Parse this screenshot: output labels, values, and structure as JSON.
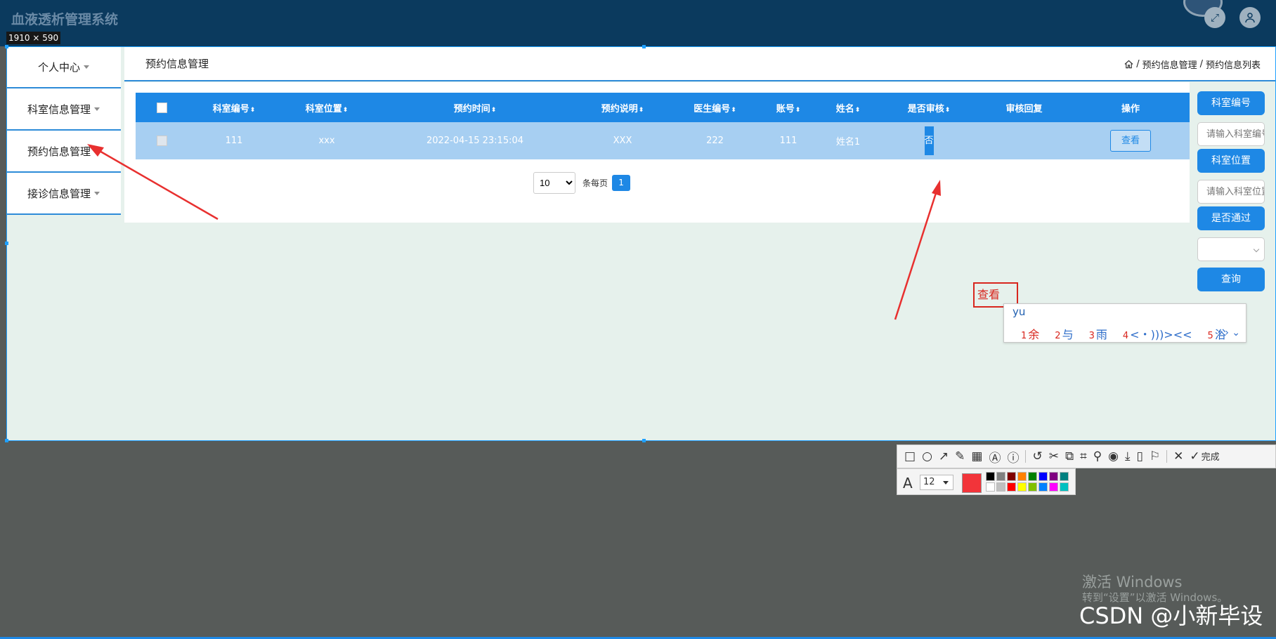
{
  "app": {
    "title": "血液透析管理系统"
  },
  "capture": {
    "dimensions": "1910 × 590"
  },
  "sidebar": {
    "items": [
      {
        "label": "个人中心"
      },
      {
        "label": "科室信息管理"
      },
      {
        "label": "预约信息管理"
      },
      {
        "label": "接诊信息管理"
      }
    ]
  },
  "header": {
    "title": "预约信息管理",
    "breadcrumb": [
      "预约信息管理",
      "预约信息列表"
    ]
  },
  "table": {
    "columns": [
      "科室编号",
      "科室位置",
      "预约时间",
      "预约说明",
      "医生编号",
      "账号",
      "姓名",
      "是否审核",
      "审核回复",
      "操作"
    ],
    "rows": [
      {
        "dept_no": "111",
        "location": "xxx",
        "time": "2022-04-15 23:15:04",
        "note": "XXX",
        "doctor_no": "222",
        "account": "111",
        "name": "姓名1",
        "reviewed": "否",
        "reply": "",
        "action": "查看"
      }
    ]
  },
  "pagination": {
    "page_size": "10",
    "per_page_label": "条每页",
    "current_page": "1"
  },
  "search_panel": {
    "dept_no_button": "科室编号",
    "dept_no_placeholder": "请输入科室编号",
    "location_button": "科室位置",
    "location_placeholder": "请输入科室位置",
    "pass_button": "是否通过",
    "pass_value": "",
    "query_button": "查询"
  },
  "annotation": {
    "text": "查看",
    "ime_input": "yu",
    "ime_candidates": [
      {
        "num": "1",
        "text": "余"
      },
      {
        "num": "2",
        "text": "与"
      },
      {
        "num": "3",
        "text": "雨"
      },
      {
        "num": "4",
        "text": "<・)))><<"
      },
      {
        "num": "5",
        "text": "浴"
      }
    ]
  },
  "screenshot_toolbar": {
    "done_label": "完成",
    "font_size": "12"
  },
  "colors": {
    "primary": "#1e88e5",
    "topbar": "#0b3a5e",
    "arrow": "#e8302f",
    "selected_row": "#a7cff2",
    "swatches": [
      "#000000",
      "#808080",
      "#800000",
      "#ff8000",
      "#008000",
      "#0000ff",
      "#800080",
      "#008080",
      "#ffffff",
      "#c0c0c0",
      "#ff0000",
      "#ffff00",
      "#80c000",
      "#0080ff",
      "#ff00ff",
      "#00c0c0"
    ]
  },
  "watermark": {
    "line1": "激活 Windows",
    "line2": "转到“设置”以激活 Windows。",
    "csdn": "CSDN @小新毕设"
  }
}
